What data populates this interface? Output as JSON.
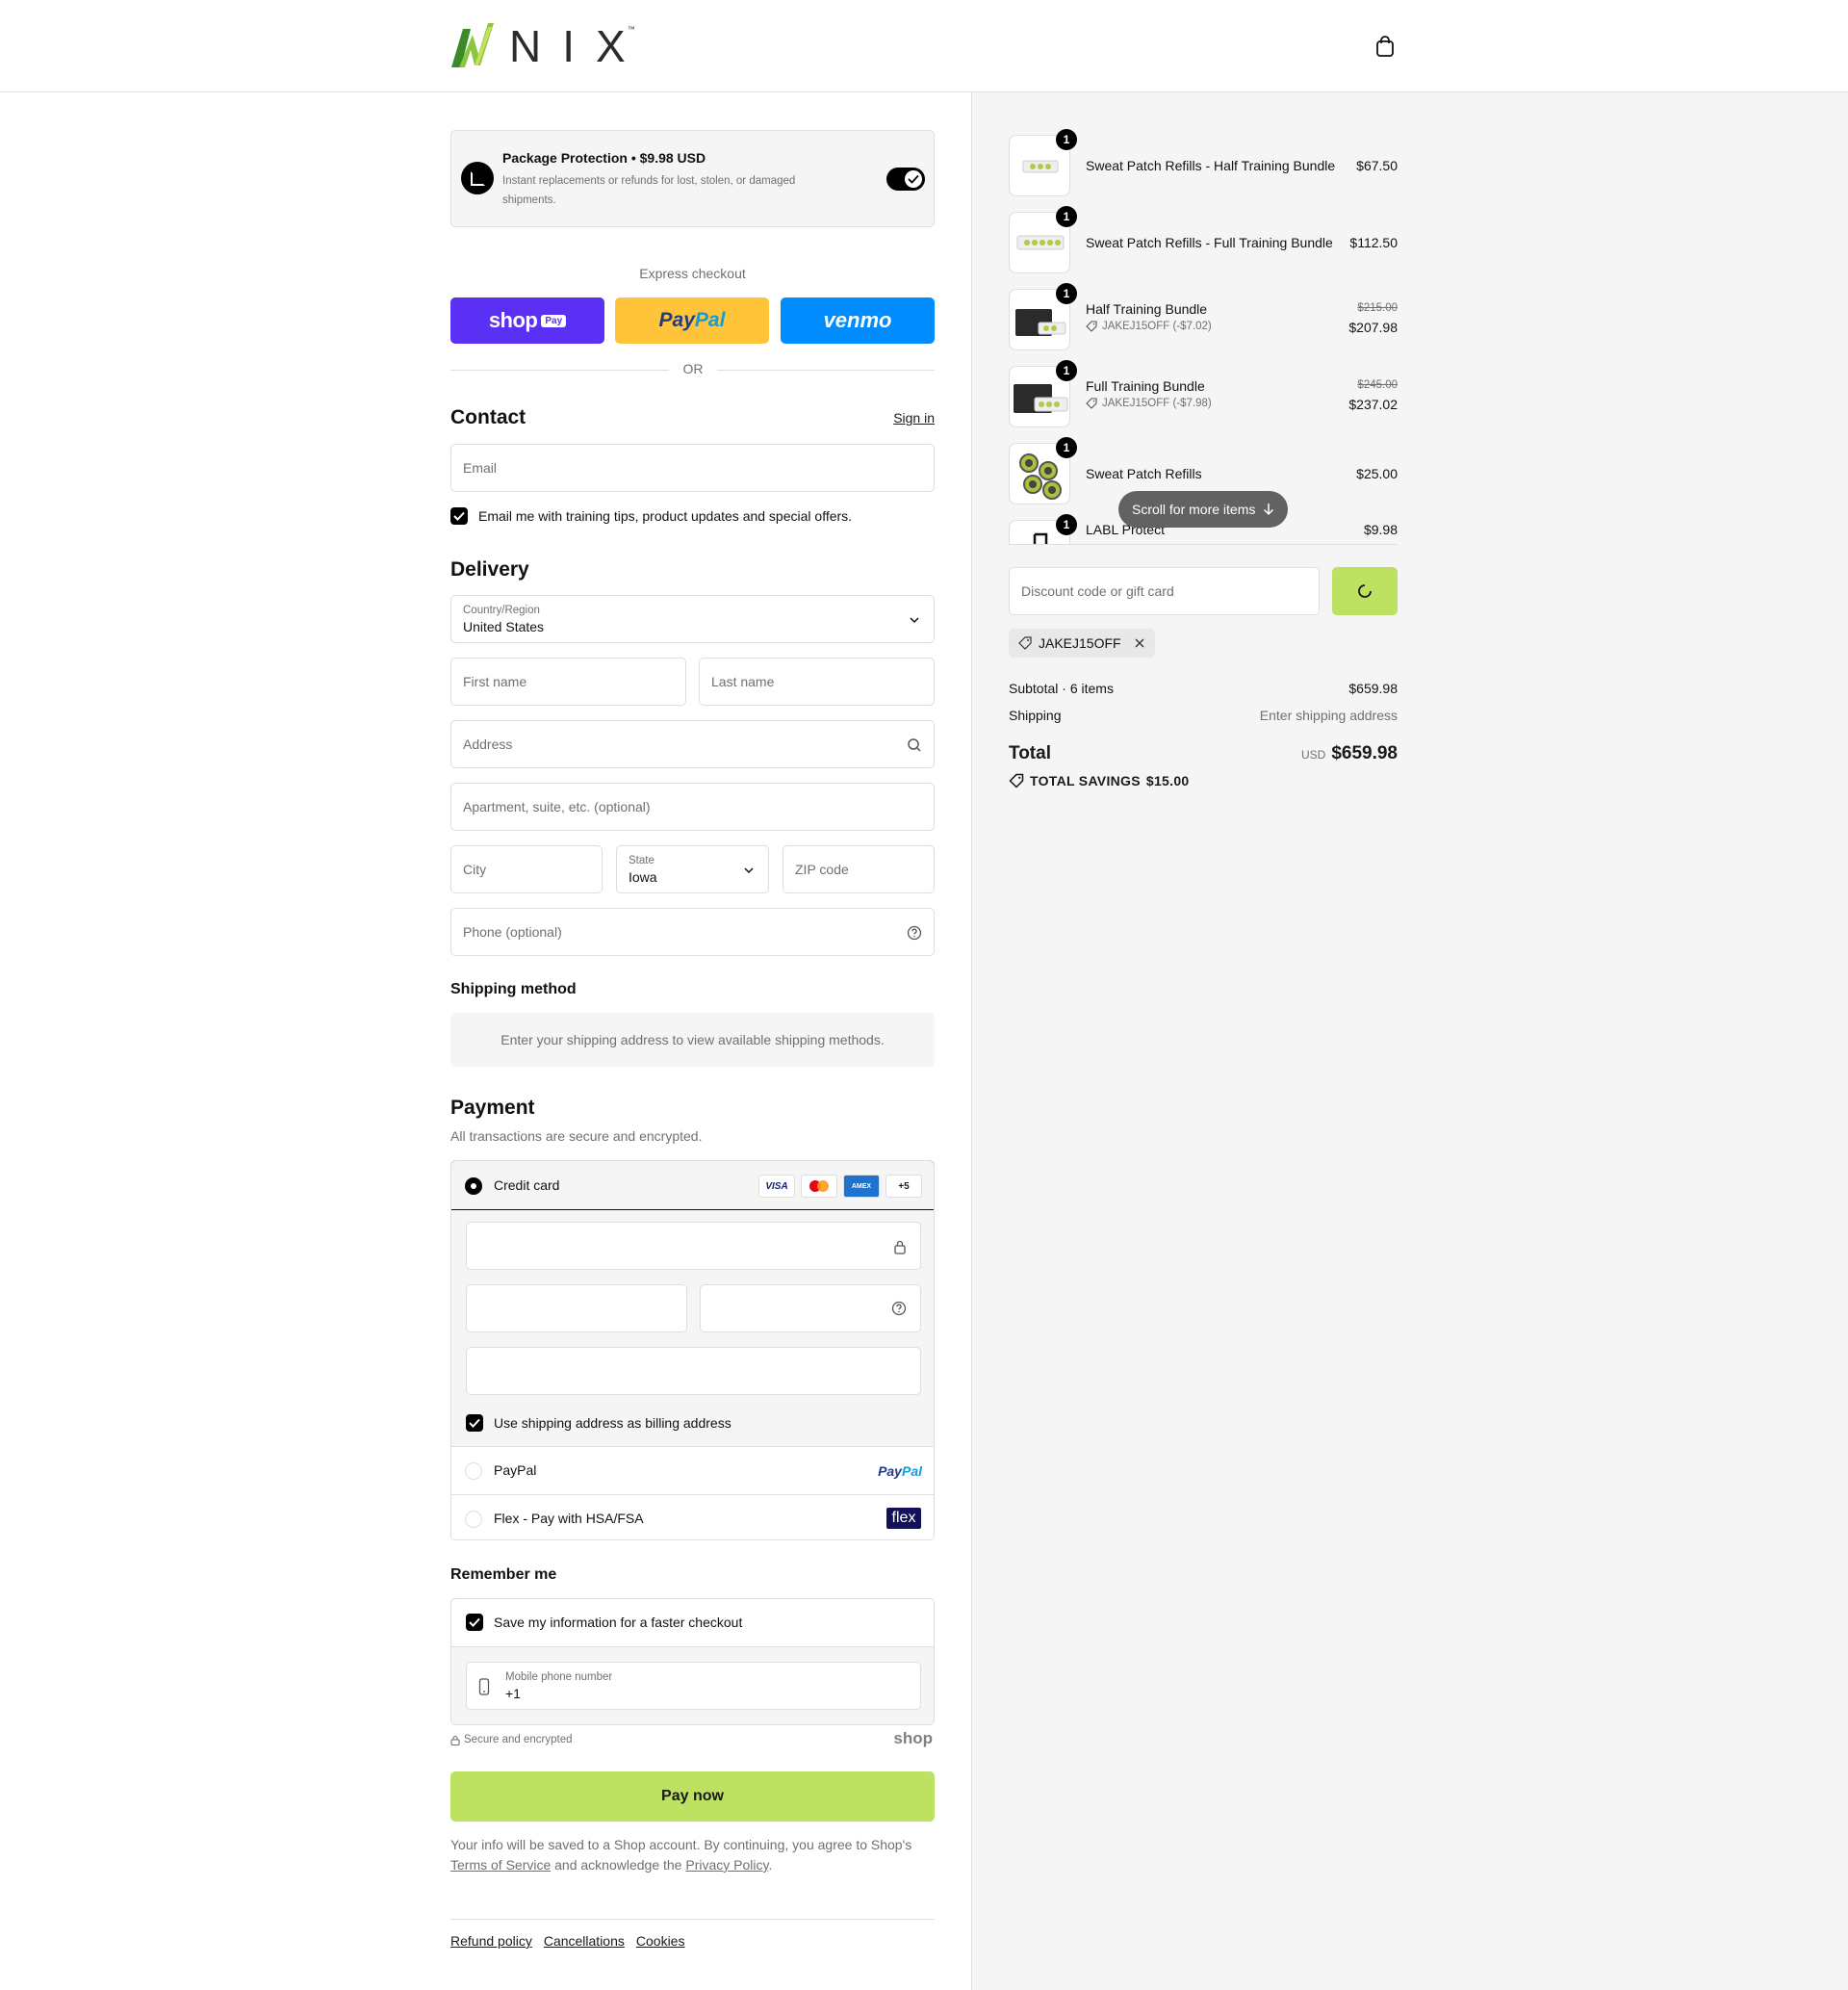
{
  "brand": {
    "name": "NIX",
    "tm": "™"
  },
  "protection": {
    "title": "Package Protection • $9.98 USD",
    "description": "Instant replacements or refunds for lost, stolen, or damaged shipments."
  },
  "express": {
    "label": "Express checkout",
    "shop_word": "shop",
    "shop_pay": "Pay",
    "paypal_p1": "Pay",
    "paypal_p2": "Pal",
    "venmo": "venmo",
    "or": "OR"
  },
  "contact": {
    "title": "Contact",
    "sign_in": "Sign in",
    "email_placeholder": "Email",
    "optin": "Email me with training tips, product updates and special offers."
  },
  "delivery": {
    "title": "Delivery",
    "country_label": "Country/Region",
    "country_value": "United States",
    "first_name": "First name",
    "last_name": "Last name",
    "address": "Address",
    "apartment": "Apartment, suite, etc. (optional)",
    "city": "City",
    "state_label": "State",
    "state_value": "Iowa",
    "zip": "ZIP code",
    "phone": "Phone (optional)"
  },
  "shipping": {
    "title": "Shipping method",
    "info": "Enter your shipping address to view available shipping methods."
  },
  "payment": {
    "title": "Payment",
    "subtitle": "All transactions are secure and encrypted.",
    "credit_card": "Credit card",
    "card_visa": "VISA",
    "card_amex": "AMEX",
    "card_more": "+5",
    "billing_same": "Use shipping address as billing address",
    "paypal": "PayPal",
    "paypal_logo_1": "Pay",
    "paypal_logo_2": "Pal",
    "flex": "Flex - Pay with HSA/FSA",
    "flex_logo": "flex"
  },
  "remember": {
    "title": "Remember me",
    "save_info": "Save my information for a faster checkout",
    "mobile_label": "Mobile phone number",
    "mobile_value": "+1"
  },
  "secure_text": "Secure and encrypted",
  "shop_brand": "shop",
  "pay_now": "Pay now",
  "legal": {
    "text1": "Your info will be saved to a Shop account. By continuing, you agree to Shop's ",
    "tos": "Terms of Service",
    "text2": " and acknowledge the ",
    "privacy": "Privacy Policy",
    "text3": "."
  },
  "footer": {
    "refund": "Refund policy",
    "cancellations": "Cancellations",
    "cookies": "Cookies"
  },
  "summary": {
    "items": [
      {
        "name": "Sweat Patch Refills - Half Training Bundle",
        "qty": "1",
        "price": "$67.50"
      },
      {
        "name": "Sweat Patch Refills - Full Training Bundle",
        "qty": "1",
        "price": "$112.50"
      },
      {
        "name": "Half Training Bundle",
        "qty": "1",
        "old_price": "$215.00",
        "price": "$207.98",
        "discount": "JAKEJ15OFF (-$7.02)"
      },
      {
        "name": "Full Training Bundle",
        "qty": "1",
        "old_price": "$245.00",
        "price": "$237.02",
        "discount": "JAKEJ15OFF (-$7.98)"
      },
      {
        "name": "Sweat Patch Refills",
        "qty": "1",
        "price": "$25.00"
      },
      {
        "name": "LABL Protect",
        "qty": "1",
        "price": "$9.98"
      }
    ],
    "scroll_hint": "Scroll for more items",
    "discount_placeholder": "Discount code or gift card",
    "applied_code": "JAKEJ15OFF",
    "subtotal_label": "Subtotal · 6 items",
    "subtotal_value": "$659.98",
    "shipping_label": "Shipping",
    "shipping_value": "Enter shipping address",
    "total_label": "Total",
    "total_currency": "USD",
    "total_value": "$659.98",
    "savings_label": "TOTAL SAVINGS",
    "savings_value": "$15.00"
  },
  "colors": {
    "accent": "#bde160",
    "shop_purple": "#5a31f4",
    "paypal_yellow": "#ffc439",
    "venmo_blue": "#008cff"
  }
}
